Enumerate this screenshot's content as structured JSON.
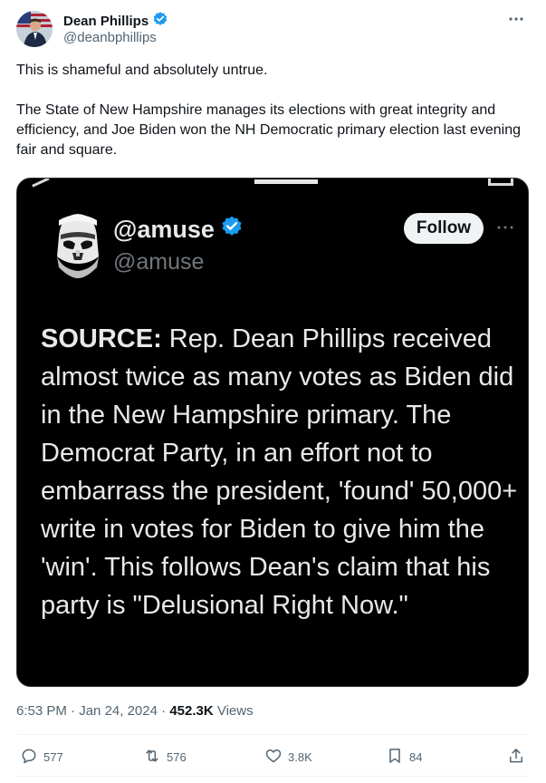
{
  "author": {
    "name": "Dean Phillips",
    "handle": "@deanbphillips"
  },
  "tweet": {
    "paragraphs": [
      "This is shameful and absolutely untrue.",
      "The State of New Hampshire manages its elections with great integrity and efficiency, and Joe Biden won the NH Democratic primary election last evening fair and square."
    ]
  },
  "quoted_media": {
    "handle_display": "@amuse",
    "handle": "@amuse",
    "follow_label": "Follow",
    "source_prefix": "SOURCE:",
    "body": " Rep. Dean Phillips received almost twice as many votes as Biden did in the New Hampshire primary. The Democrat Party, in an effort not to embarrass the president, 'found' 50,000+ write in votes for Biden to give him the 'win'. This follows Dean's claim that his party is \"Delusional Right Now.\""
  },
  "meta": {
    "time": "6:53 PM",
    "sep1": " · ",
    "date": "Jan 24, 2024",
    "sep2": " · ",
    "views_count": "452.3K",
    "views_label": " Views"
  },
  "actions": {
    "replies": "577",
    "reposts": "576",
    "likes": "3.8K",
    "bookmarks": "84"
  },
  "colors": {
    "verified": "#1d9bf0",
    "text": "#0f1419",
    "muted": "#536471"
  },
  "icons": [
    "verified-badge-icon",
    "more-icon",
    "reply-icon",
    "repost-icon",
    "like-icon",
    "bookmark-icon",
    "share-icon"
  ]
}
